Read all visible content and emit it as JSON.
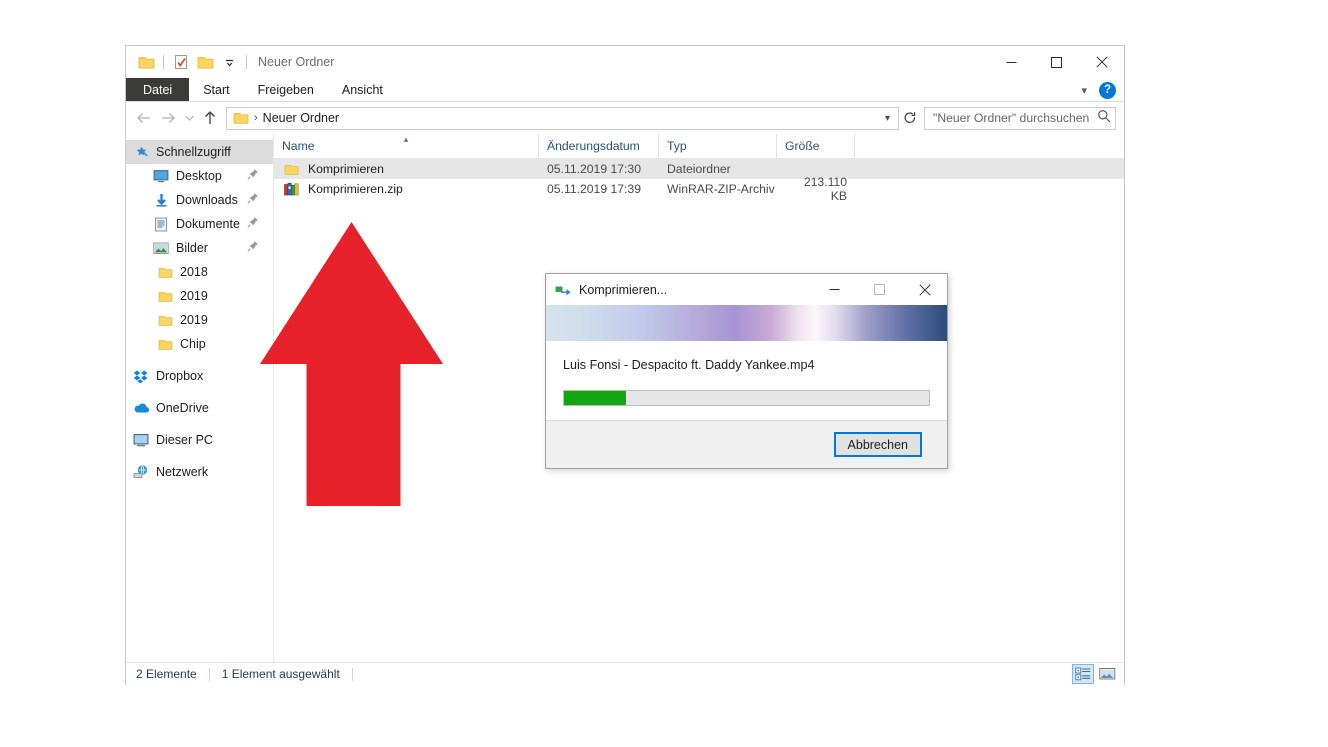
{
  "window": {
    "title": "Neuer Ordner",
    "controls": {
      "minimize": "minimize-icon",
      "maximize": "maximize-icon",
      "close": "close-icon"
    },
    "quick_access": [
      {
        "name": "folder-icon",
        "label": "Ordner"
      },
      {
        "name": "properties-icon",
        "label": "Eigenschaften"
      },
      {
        "name": "new-folder-icon",
        "label": "Neuer Ordner"
      },
      {
        "name": "chevron-down-icon",
        "label": "Symbolleiste anpassen"
      }
    ]
  },
  "ribbon": {
    "tabs": [
      {
        "label": "Datei",
        "active": true
      },
      {
        "label": "Start",
        "active": false
      },
      {
        "label": "Freigeben",
        "active": false
      },
      {
        "label": "Ansicht",
        "active": false
      }
    ],
    "collapse_icon": "chevron-down-icon",
    "help_label": "?"
  },
  "address": {
    "back_icon": "arrow-left-icon",
    "forward_icon": "arrow-right-icon",
    "history_icon": "chevron-down-icon",
    "up_icon": "arrow-up-icon",
    "folder_icon": "folder-icon",
    "separator": "›",
    "path_text": "Neuer Ordner",
    "dropdown_icon": "chevron-down-icon",
    "refresh_icon": "refresh-icon"
  },
  "search": {
    "placeholder": "\"Neuer Ordner\" durchsuchen",
    "value": "",
    "icon": "search-icon"
  },
  "sidebar": {
    "items": [
      {
        "label": "Schnellzugriff",
        "icon": "star-pin-icon",
        "level": "root",
        "selected": true,
        "pinned": false
      },
      {
        "label": "Desktop",
        "icon": "desktop-icon",
        "level": "lvl2",
        "selected": false,
        "pinned": true
      },
      {
        "label": "Downloads",
        "icon": "download-icon",
        "level": "lvl2",
        "selected": false,
        "pinned": true
      },
      {
        "label": "Dokumente",
        "icon": "documents-icon",
        "level": "lvl2",
        "selected": false,
        "pinned": true
      },
      {
        "label": "Bilder",
        "icon": "pictures-icon",
        "level": "lvl2",
        "selected": false,
        "pinned": true
      },
      {
        "label": "2018",
        "icon": "folder-icon",
        "level": "lvl3",
        "selected": false,
        "pinned": false
      },
      {
        "label": "2019",
        "icon": "folder-icon",
        "level": "lvl3",
        "selected": false,
        "pinned": false
      },
      {
        "label": "2019",
        "icon": "folder-icon",
        "level": "lvl3",
        "selected": false,
        "pinned": false
      },
      {
        "label": "Chip",
        "icon": "folder-icon",
        "level": "lvl3",
        "selected": false,
        "pinned": false
      },
      {
        "label": "Dropbox",
        "icon": "dropbox-icon",
        "level": "root",
        "selected": false,
        "pinned": false,
        "spaced": true
      },
      {
        "label": "OneDrive",
        "icon": "onedrive-cloud-icon",
        "level": "root",
        "selected": false,
        "pinned": false,
        "spaced": true
      },
      {
        "label": "Dieser PC",
        "icon": "this-pc-icon",
        "level": "root",
        "selected": false,
        "pinned": false,
        "spaced": true
      },
      {
        "label": "Netzwerk",
        "icon": "network-icon",
        "level": "root",
        "selected": false,
        "pinned": false,
        "spaced": true
      }
    ]
  },
  "file_list": {
    "columns": [
      {
        "label": "Name",
        "sorted": true,
        "sort_dir": "asc"
      },
      {
        "label": "Änderungsdatum",
        "sorted": false
      },
      {
        "label": "Typ",
        "sorted": false
      },
      {
        "label": "Größe",
        "sorted": false
      }
    ],
    "rows": [
      {
        "name": "Komprimieren",
        "icon": "folder-icon",
        "date": "05.11.2019 17:30",
        "type": "Dateiordner",
        "size": "",
        "selected": true
      },
      {
        "name": "Komprimieren.zip",
        "icon": "winrar-archive-icon",
        "date": "05.11.2019 17:39",
        "type": "WinRAR-ZIP-Archiv",
        "size": "213.110 KB",
        "selected": false
      }
    ]
  },
  "statusbar": {
    "item_count": "2 Elemente",
    "selection": "1 Element ausgewählt",
    "view_buttons": [
      {
        "name": "details-view-icon",
        "active": true
      },
      {
        "name": "large-icons-view-icon",
        "active": false
      }
    ]
  },
  "dialog": {
    "title": "Komprimieren...",
    "icon": "compress-icon",
    "controls": {
      "minimize": "minimize-icon",
      "maximize": "maximize-icon",
      "close": "close-icon"
    },
    "filename": "Luis Fonsi - Despacito ft. Daddy Yankee.mp4",
    "progress_percent": 17,
    "progress_color": "#13a610",
    "cancel_label": "Abbrechen",
    "focus_color": "#0078d7"
  },
  "annotation": {
    "arrow": {
      "name": "red-up-arrow",
      "color": "#e62129",
      "direction": "up"
    }
  },
  "colors": {
    "accent": "#0078d7",
    "folder_yellow": "#fcd462",
    "selection_gray": "#e6e6e6",
    "ribbon_file_tab": "#3b3b39"
  }
}
